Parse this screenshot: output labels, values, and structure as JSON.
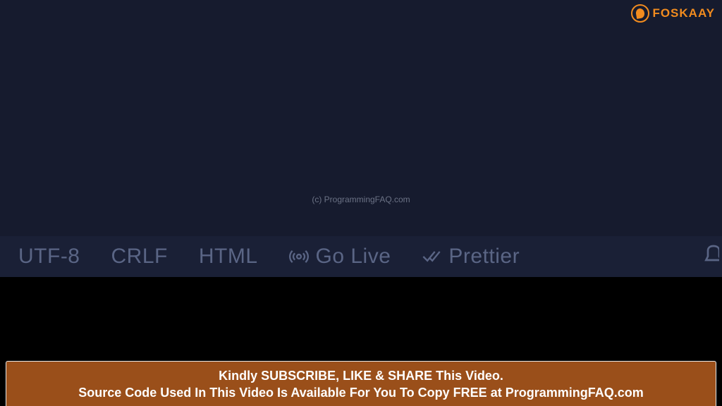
{
  "brand": {
    "name": "FOSKAAY"
  },
  "watermark": "(c) ProgrammingFAQ.com",
  "statusbar": {
    "encoding": "UTF-8",
    "eol": "CRLF",
    "language": "HTML",
    "golive": "Go Live",
    "formatter": "Prettier"
  },
  "cta": {
    "line1": "Kindly SUBSCRIBE, LIKE & SHARE This Video.",
    "line2": "Source Code Used In This Video Is Available For You To Copy  FREE at  ProgrammingFAQ.com"
  }
}
